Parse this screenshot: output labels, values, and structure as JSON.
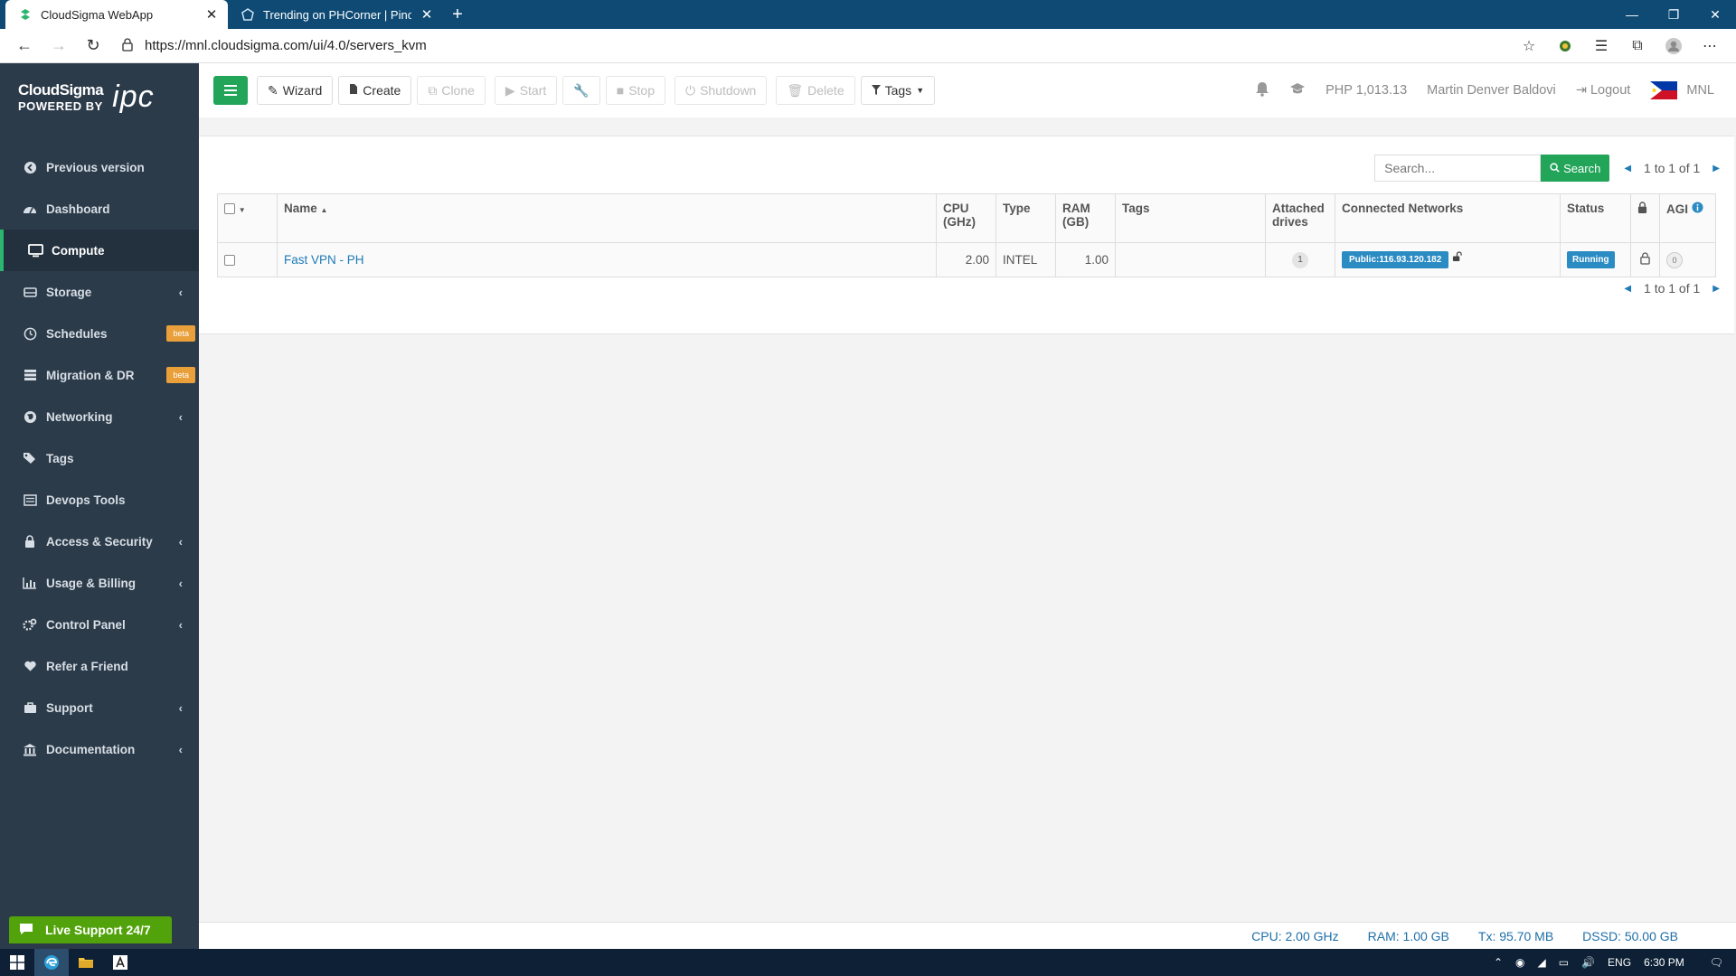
{
  "browser": {
    "tabs": [
      {
        "title": "CloudSigma WebApp",
        "active": true
      },
      {
        "title": "Trending on PHCorner | Pinoy In",
        "active": false
      }
    ],
    "url": "https://mnl.cloudsigma.com/ui/4.0/servers_kvm"
  },
  "brand": {
    "name": "CloudSigma",
    "powered_by": "POWERED BY",
    "partner": "ipc"
  },
  "sidebar": {
    "items": [
      {
        "label": "Previous version",
        "icon": "back-circle-icon"
      },
      {
        "label": "Dashboard",
        "icon": "dashboard-icon"
      },
      {
        "label": "Compute",
        "icon": "monitor-icon",
        "active": true
      },
      {
        "label": "Storage",
        "icon": "storage-icon",
        "chevron": true
      },
      {
        "label": "Schedules",
        "icon": "clock-icon",
        "badge": "beta"
      },
      {
        "label": "Migration & DR",
        "icon": "server-icon",
        "badge": "beta"
      },
      {
        "label": "Networking",
        "icon": "globe-icon",
        "chevron": true
      },
      {
        "label": "Tags",
        "icon": "tags-icon"
      },
      {
        "label": "Devops Tools",
        "icon": "list-icon"
      },
      {
        "label": "Access & Security",
        "icon": "lock-icon",
        "chevron": true
      },
      {
        "label": "Usage & Billing",
        "icon": "chart-icon",
        "chevron": true
      },
      {
        "label": "Control Panel",
        "icon": "cogs-icon",
        "chevron": true
      },
      {
        "label": "Refer a Friend",
        "icon": "heart-icon"
      },
      {
        "label": "Support",
        "icon": "support-icon",
        "chevron": true
      },
      {
        "label": "Documentation",
        "icon": "bank-icon",
        "chevron": true
      }
    ],
    "live_support": "Live Support 24/7"
  },
  "toolbar": {
    "wizard": "Wizard",
    "create": "Create",
    "clone": "Clone",
    "start": "Start",
    "stop": "Stop",
    "shutdown": "Shutdown",
    "delete": "Delete",
    "tags": "Tags",
    "balance": "PHP 1,013.13",
    "user": "Martin Denver Baldovi",
    "logout": "Logout",
    "location": "MNL"
  },
  "search": {
    "placeholder": "Search...",
    "button": "Search",
    "pagination": "1 to 1 of 1"
  },
  "table": {
    "headers": {
      "name": "Name",
      "cpu": "CPU (GHz)",
      "type": "Type",
      "ram": "RAM (GB)",
      "tags": "Tags",
      "drives": "Attached drives",
      "networks": "Connected Networks",
      "status": "Status",
      "agi": "AGI"
    },
    "rows": [
      {
        "name": "Fast VPN - PH",
        "cpu": "2.00",
        "type": "INTEL",
        "ram": "1.00",
        "tags": "",
        "drives": "1",
        "network": "Public:116.93.120.182",
        "status": "Running",
        "agi": "0"
      }
    ]
  },
  "statusbar": {
    "cpu": "CPU: 2.00 GHz",
    "ram": "RAM: 1.00 GB",
    "tx": "Tx: 95.70 MB",
    "dssd": "DSSD: 50.00 GB"
  },
  "taskbar": {
    "lang": "ENG",
    "time": "6:30 PM"
  },
  "colors": {
    "sidebar": "#2c3b4a",
    "accent_green": "#22a559",
    "link_blue": "#1e7bb7",
    "badge_blue": "#2b8bc3",
    "beta_orange": "#e9a03b"
  }
}
